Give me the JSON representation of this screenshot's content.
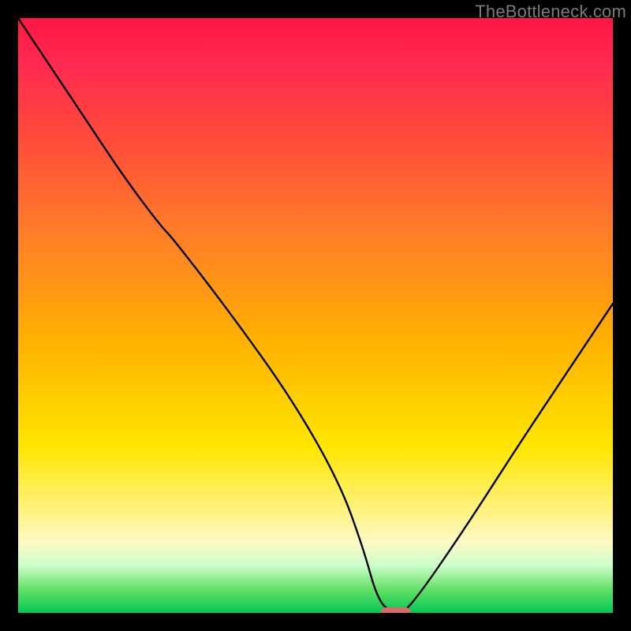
{
  "watermark": "TheBottleneck.com",
  "chart_data": {
    "type": "line",
    "title": "",
    "xlabel": "",
    "ylabel": "",
    "xlim": [
      0,
      100
    ],
    "ylim": [
      0,
      100
    ],
    "background_gradient": {
      "top_color": "#ff1744",
      "bottom_color": "#00c853",
      "meaning": "top=high bottleneck, bottom=low bottleneck"
    },
    "series": [
      {
        "name": "bottleneck-curve",
        "color": "#000000",
        "x": [
          0,
          6,
          12,
          18,
          24,
          26,
          36,
          46,
          54,
          58,
          60.5,
          63,
          64,
          66,
          75,
          84,
          92,
          100
        ],
        "y": [
          100,
          91,
          82,
          73,
          65,
          63,
          50,
          36,
          22,
          11,
          2,
          0,
          0,
          1,
          14,
          28,
          40,
          52
        ]
      }
    ],
    "marker": {
      "name": "optimal-point",
      "x_range": [
        61,
        66
      ],
      "y": 0,
      "color": "#d86a6a",
      "shape": "pill"
    }
  }
}
